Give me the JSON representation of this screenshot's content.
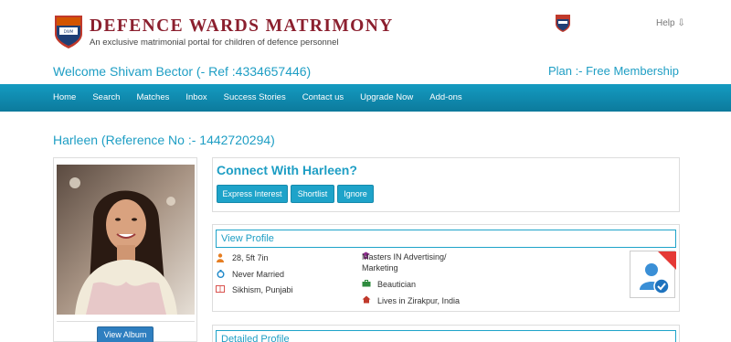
{
  "header": {
    "brand_title": "DEFENCE WARDS MATRIMONY",
    "brand_subtitle": "An exclusive matrimonial portal for children of defence personnel",
    "logo_icon": "shield-emblem-icon",
    "help_label": "Help ⇩"
  },
  "welcome": {
    "text": "Welcome Shivam Bector (- Ref :4334657446)",
    "plan": "Plan :- Free Membership"
  },
  "nav": {
    "items": [
      "Home",
      "Search",
      "Matches",
      "Inbox",
      "Success Stories",
      "Contact us",
      "Upgrade Now",
      "Add-ons"
    ]
  },
  "profile": {
    "heading": "Harleen (Reference No :- 1442720294)",
    "album_button": "View Album",
    "connect_title": "Connect With Harleen?",
    "actions": {
      "express_interest": "Express Interest",
      "shortlist": "Shortlist",
      "ignore": "Ignore"
    },
    "view_profile_title": "View Profile",
    "details": {
      "age_height": "28, 5ft 7in",
      "marital_status": "Never Married",
      "religion": "Sikhism, Punjabi",
      "education_line1": "Masters IN Advertising/",
      "education_line2": "Marketing",
      "occupation": "Beautician",
      "location": "Lives in Zirakpur, India"
    },
    "detailed_profile_title": "Detailed Profile"
  },
  "colors": {
    "brand": "#8b1f2e",
    "accent": "#1e9ec4",
    "nav_bg": "#0f8db3",
    "album_button": "#2f7fc0"
  }
}
